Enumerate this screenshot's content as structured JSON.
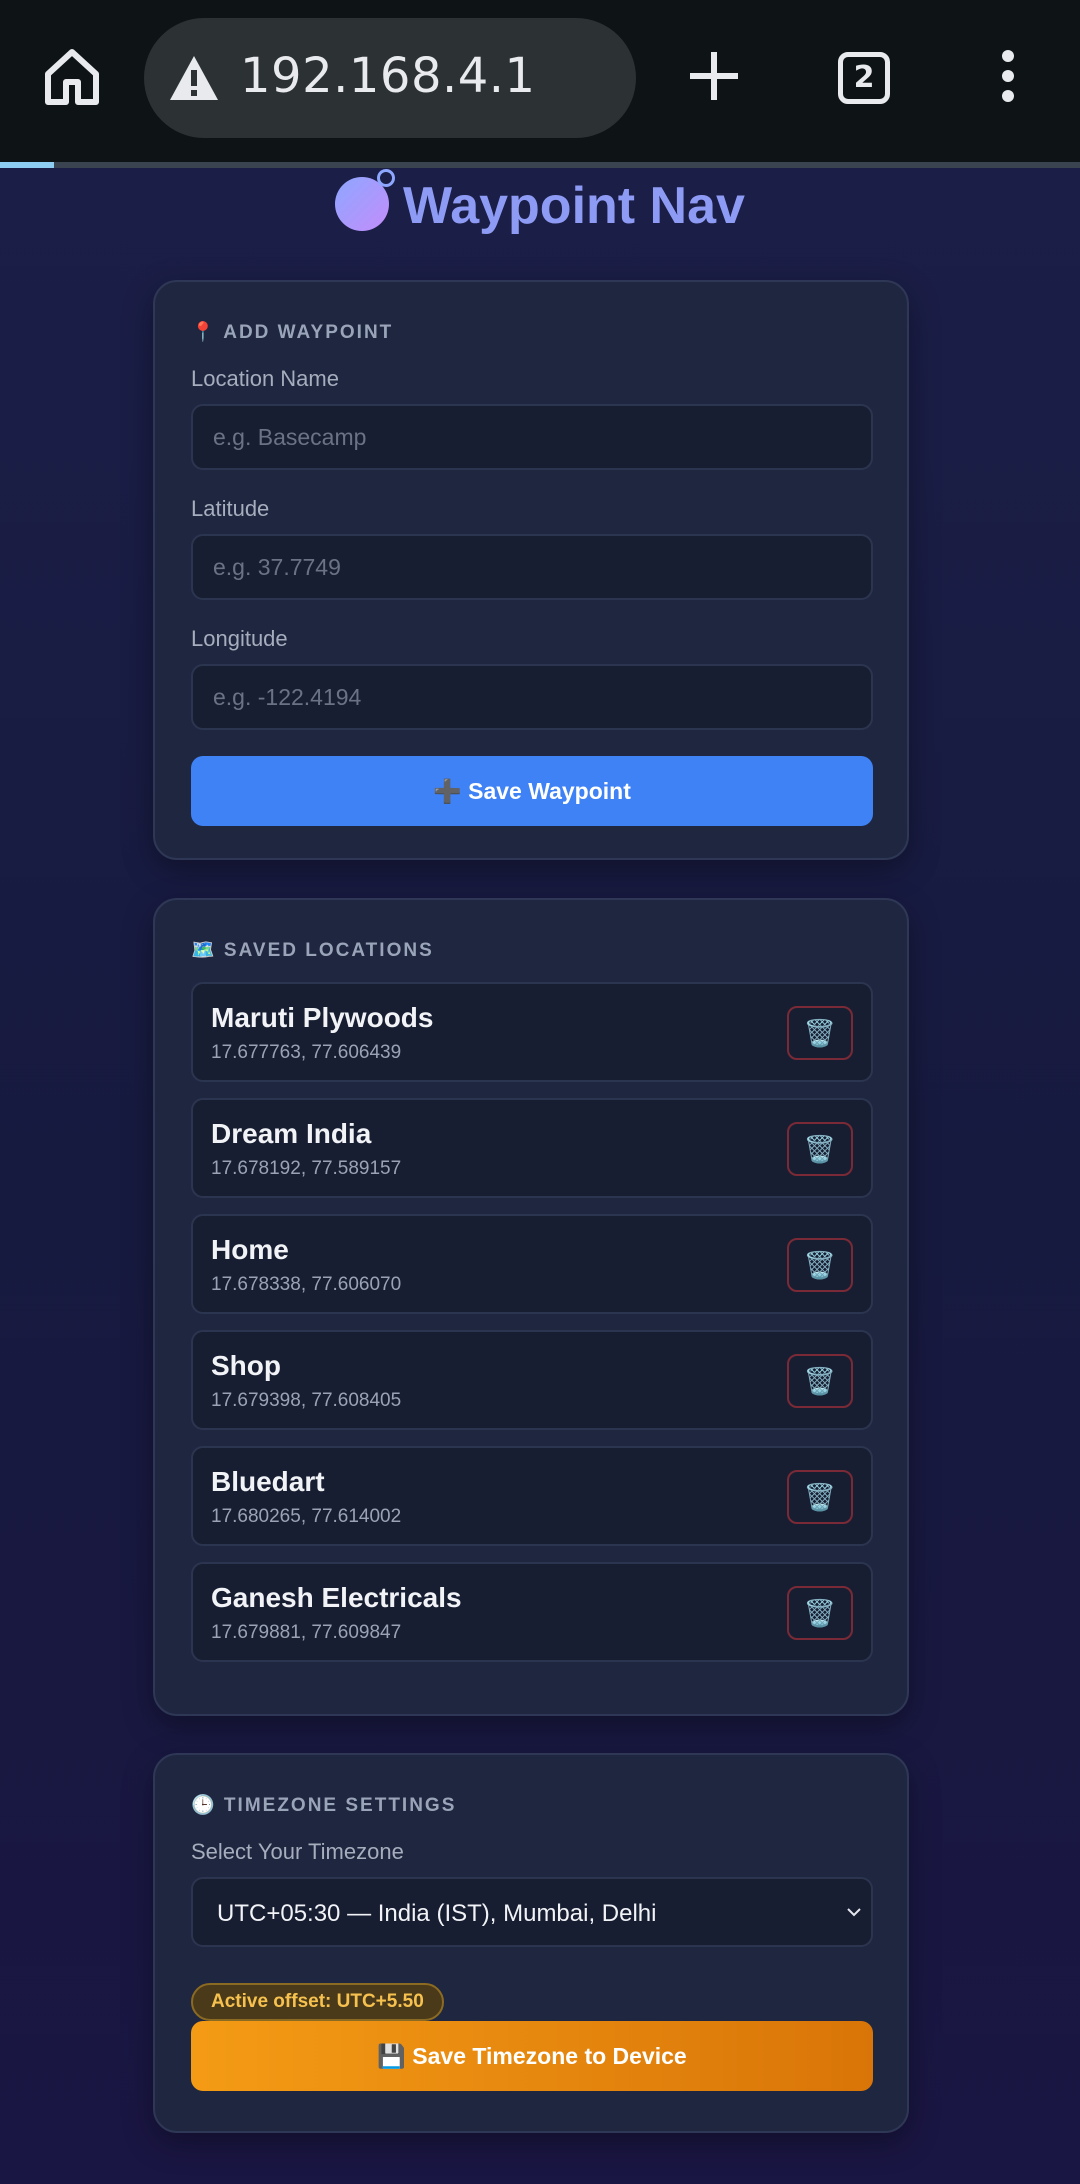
{
  "browser": {
    "url": "192.168.4.1",
    "tab_count": "2",
    "load_progress": 0.05
  },
  "app": {
    "title": "Waypoint Nav"
  },
  "add_waypoint": {
    "header": "📍 ADD WAYPOINT",
    "name_label": "Location Name",
    "name_placeholder": "e.g. Basecamp",
    "lat_label": "Latitude",
    "lat_placeholder": "e.g. 37.7749",
    "lon_label": "Longitude",
    "lon_placeholder": "e.g. -122.4194",
    "save_label": "➕ Save Waypoint"
  },
  "saved_locations": {
    "header": "🗺️ SAVED LOCATIONS",
    "delete_icon": "🗑️",
    "items": [
      {
        "name": "Maruti Plywoods",
        "coords": "17.677763, 77.606439"
      },
      {
        "name": "Dream India",
        "coords": "17.678192, 77.589157"
      },
      {
        "name": "Home",
        "coords": "17.678338, 77.606070"
      },
      {
        "name": "Shop",
        "coords": "17.679398, 77.608405"
      },
      {
        "name": "Bluedart",
        "coords": "17.680265, 77.614002"
      },
      {
        "name": "Ganesh Electricals",
        "coords": "17.679881, 77.609847"
      }
    ]
  },
  "timezone": {
    "header": "🕒 TIMEZONE SETTINGS",
    "select_label": "Select Your Timezone",
    "selected": "UTC+05:30 — India (IST), Mumbai, Delhi",
    "active_offset": "Active offset: UTC+5.50",
    "save_label": "💾 Save Timezone to Device"
  },
  "colors": {
    "accent_blue": "#3f82f5",
    "accent_orange": "#f49b15",
    "title": "#8e9bf5",
    "delete_border": "#7a2a36"
  }
}
